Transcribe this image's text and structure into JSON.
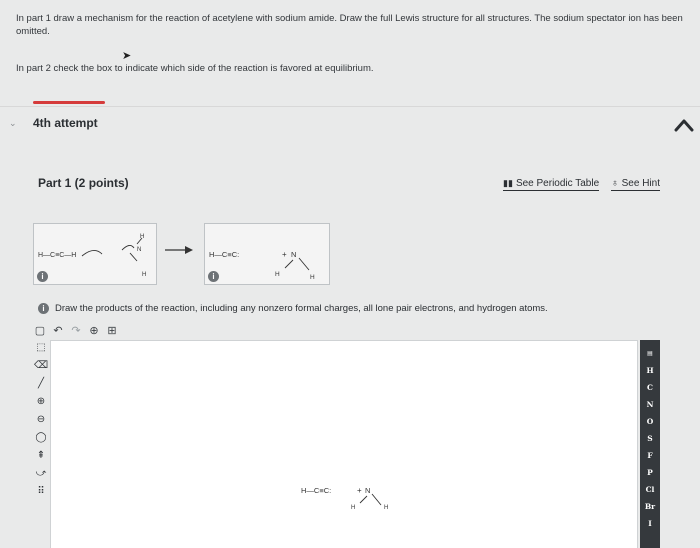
{
  "intro": {
    "part1": "In part 1 draw a mechanism for the reaction of acetylene with sodium amide. Draw the full Lewis structure for all structures. The sodium spectator ion has been omitted.",
    "part2": "In part 2 check the box to indicate which side of the reaction is favored at equilibrium."
  },
  "attempt": {
    "label": "4th attempt"
  },
  "part": {
    "title": "Part 1  (2 points)",
    "periodic_link": "See Periodic Table",
    "hint_link": "See Hint"
  },
  "reaction": {
    "reactant_text": "H—C≡C—H",
    "product_text": "H—C≡C:",
    "plus": "+",
    "amine_N": "N",
    "H": "H"
  },
  "instruction": "Draw the products of the reaction, including any nonzero formal charges, all lone pair electrons, and hydrogen atoms.",
  "canvas_structure": {
    "text": "H—C≡C:",
    "plus": "+",
    "N": "N",
    "H": "H"
  },
  "periodic_elements": [
    "H",
    "C",
    "N",
    "O",
    "S",
    "F",
    "P",
    "Cl",
    "Br",
    "I"
  ],
  "icons": {
    "cursor": "pointer-icon",
    "collapse": "chevron-up-icon",
    "expand": "chevron-down-icon"
  }
}
